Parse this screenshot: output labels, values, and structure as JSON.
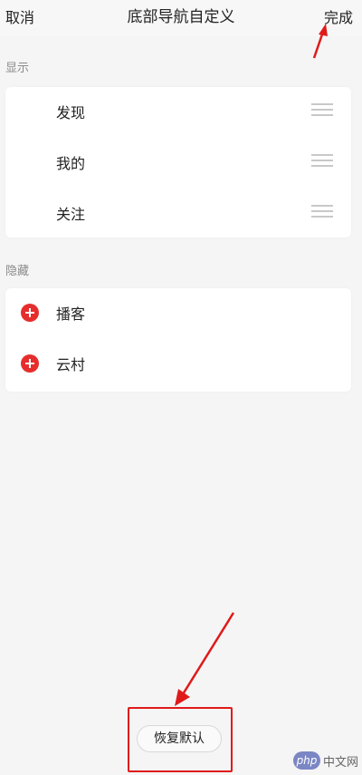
{
  "header": {
    "cancel_label": "取消",
    "title": "底部导航自定义",
    "done_label": "完成"
  },
  "sections": {
    "visible_label": "显示",
    "visible_items": [
      {
        "label": "发现",
        "handle_icon": "drag-handle-icon"
      },
      {
        "label": "我的",
        "handle_icon": "drag-handle-icon"
      },
      {
        "label": "关注",
        "handle_icon": "drag-handle-icon"
      }
    ],
    "hidden_label": "隐藏",
    "hidden_items": [
      {
        "label": "播客",
        "add_icon": "add-circle-icon"
      },
      {
        "label": "云村",
        "add_icon": "add-circle-icon"
      }
    ]
  },
  "footer": {
    "restore_label": "恢复默认"
  },
  "watermark": {
    "badge": "php",
    "text": "中文网"
  },
  "colors": {
    "accent_red": "#e62d2d",
    "annotation_red": "#e01a1a",
    "background": "#f5f5f5"
  }
}
